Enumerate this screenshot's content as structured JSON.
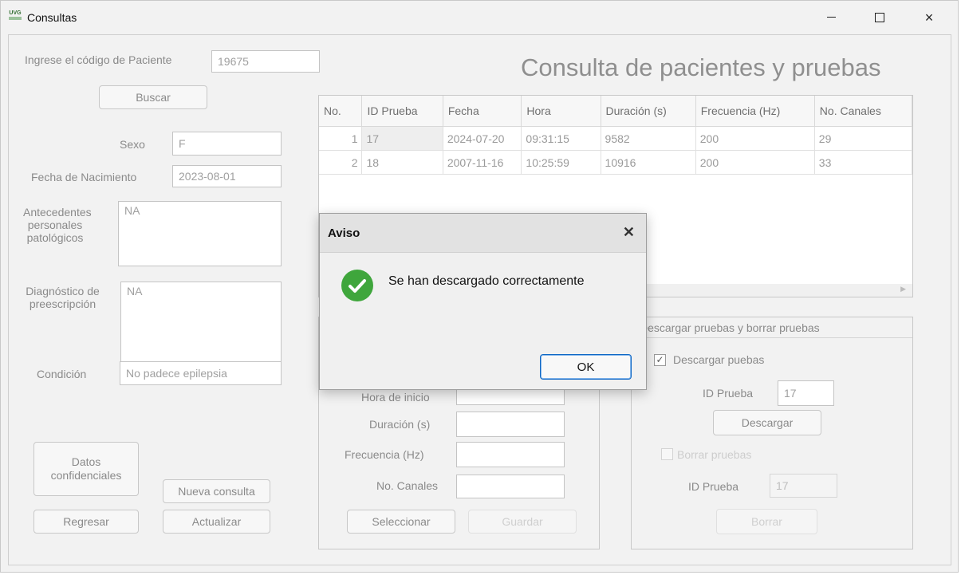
{
  "window": {
    "logo_text": "UVG",
    "title": "Consultas",
    "min_label": "",
    "close_label": "×"
  },
  "left": {
    "codigo_label": "Ingrese el código de Paciente",
    "codigo_value": "19675",
    "buscar_label": "Buscar",
    "sexo_label": "Sexo",
    "sexo_value": "F",
    "fecha_nac_label": "Fecha de Nacimiento",
    "fecha_nac_value": "2023-08-01",
    "antecedentes_label": "Antecedentes personales patológicos",
    "antecedentes_value": "NA",
    "diagnostico_label": "Diagnóstico de preescripción",
    "diagnostico_value": "NA",
    "condicion_label": "Condición",
    "condicion_value": "No padece epilepsia",
    "datos_conf_label": "Datos confidenciales",
    "nueva_consulta_label": "Nueva consulta",
    "regresar_label": "Regresar",
    "actualizar_label": "Actualizar"
  },
  "heading": "Consulta de pacientes y pruebas",
  "table": {
    "columns": [
      "No.",
      "ID Prueba",
      "Fecha",
      "Hora",
      "Duración (s)",
      "Frecuencia (Hz)",
      "No. Canales"
    ],
    "rows": [
      [
        "1",
        "17",
        "2024-07-20",
        "09:31:15",
        "9582",
        "200",
        "29"
      ],
      [
        "2",
        "18",
        "2007-11-16",
        "10:25:59",
        "10916",
        "200",
        "33"
      ]
    ]
  },
  "middle_form": {
    "hora_inicio_label": "Hora de inicio",
    "duracion_label": "Duración (s)",
    "frecuencia_label": "Frecuencia (Hz)",
    "canales_label": "No. Canales",
    "seleccionar_label": "Seleccionar",
    "guardar_label": "Guardar"
  },
  "download_panel": {
    "title": "Descargar pruebas y borrar pruebas",
    "descargar_check_label": "Descargar puebas",
    "descargar_checked": true,
    "id_prueba_label": "ID Prueba",
    "id_prueba_value": "17",
    "descargar_button": "Descargar",
    "borrar_check_label": "Borrar pruebas",
    "borrar_checked": false,
    "id_prueba_borrar_label": "ID Prueba",
    "id_prueba_borrar_value": "17",
    "borrar_button": "Borrar"
  },
  "dialog": {
    "title": "Aviso",
    "message": "Se han descargado correctamente",
    "ok_label": "OK",
    "icon": "success-check-icon",
    "icon_color": "#3fa63c"
  }
}
